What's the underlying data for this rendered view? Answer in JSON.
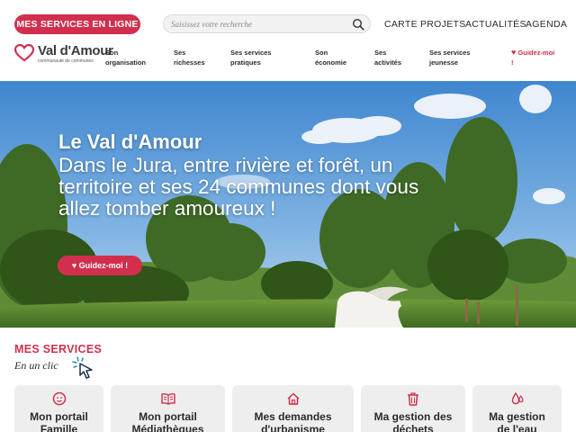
{
  "header": {
    "services_button": "MES SERVICES EN LIGNE",
    "search_placeholder": "Saisissez votre recherche",
    "top_links": [
      "CARTE",
      "PROJETS",
      "ACTUALITÉS",
      "AGENDA"
    ]
  },
  "logo": {
    "name": "Val d'Amour",
    "tagline": "communauté de communes"
  },
  "nav": {
    "items": [
      {
        "line1": "Son",
        "line2": "organisation"
      },
      {
        "line1": "Ses",
        "line2": "richesses"
      },
      {
        "line1": "Ses services",
        "line2": "pratiques"
      },
      {
        "line1": "Son",
        "line2": "économie"
      },
      {
        "line1": "Ses",
        "line2": "activités"
      },
      {
        "line1": "Ses services",
        "line2": "jeunesse"
      }
    ],
    "guide_line1": "Guidez-moi",
    "guide_line2": "!"
  },
  "hero": {
    "title": "Le Val d'Amour",
    "subtitle": "Dans le Jura, entre rivière et forêt, un territoire et ses 24 communes dont vous allez tomber amoureux !",
    "guide_button": "Guidez-moi !"
  },
  "services": {
    "title": "MES SERVICES",
    "subtitle": "En un clic",
    "cards": [
      {
        "icon": "family-icon",
        "line1": "Mon portail",
        "line2": "Famille"
      },
      {
        "icon": "book-icon",
        "line1": "Mon portail",
        "line2": "Médiathèques"
      },
      {
        "icon": "house-icon",
        "line1": "Mes demandes",
        "line2": "d'urbanisme"
      },
      {
        "icon": "trash-icon",
        "line1": "Ma gestion des",
        "line2": "déchets"
      },
      {
        "icon": "water-drop-icon",
        "line1": "Ma gestion",
        "line2": "de l'eau"
      }
    ]
  },
  "colors": {
    "accent": "#d12f4d",
    "card_bg": "#eeeeee",
    "text": "#2b2b2b"
  }
}
